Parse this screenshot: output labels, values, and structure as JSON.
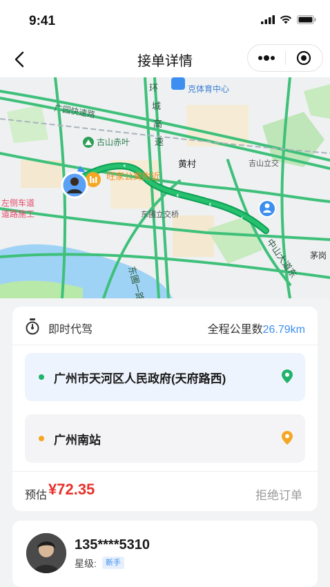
{
  "status_bar": {
    "time": "9:41"
  },
  "nav": {
    "title": "接单详情"
  },
  "map": {
    "labels": {
      "expressway": "广园快速路",
      "highway_vertical": "环城高速",
      "gushan": "古山赤叶",
      "huangcun": "黄村",
      "jishan": "吉山立交",
      "donpu": "东圃立交桥",
      "wangjia": "旺家公寓附近",
      "left_lane": "左侧车道",
      "road_work": "道路施工",
      "sports": "克体育中心",
      "maogang": "茅岗",
      "zhongshan": "中山大道东",
      "dongpu_road": "东圃一路"
    }
  },
  "order": {
    "type": "即时代驾",
    "distance_label": "全程公里数",
    "distance_value": "26.79km",
    "from": "广州市天河区人民政府(天府路西)",
    "to": "广州南站",
    "estimate_label": "预估",
    "estimate_price": "¥72.35",
    "reject": "拒绝订单"
  },
  "user": {
    "phone": "135****5310",
    "level_label": "星级:",
    "level": "新手"
  },
  "colors": {
    "accent": "#3c8ff0",
    "route": "#21b36a",
    "price": "#e8312a",
    "from_dot": "#21b36a",
    "to_dot": "#f5a623"
  }
}
